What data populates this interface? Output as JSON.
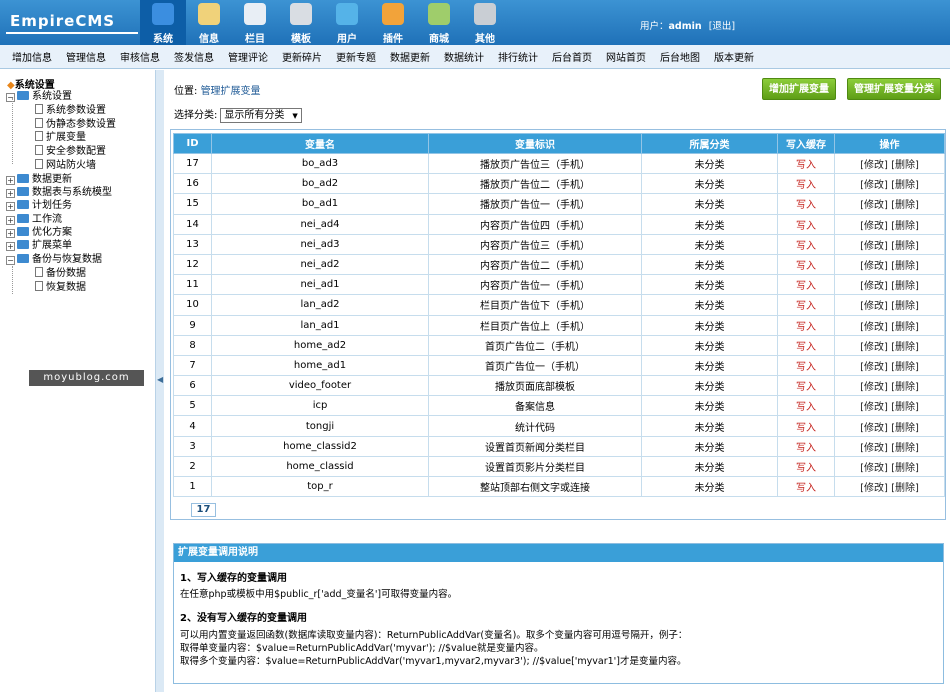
{
  "logo": "EmpireCMS",
  "topnav": [
    {
      "label": "系统",
      "icon": "globe-icon",
      "color": "#3b8ee0",
      "active": true
    },
    {
      "label": "信息",
      "icon": "document-edit-icon",
      "color": "#f0d27a"
    },
    {
      "label": "栏目",
      "icon": "folder-icon",
      "color": "#e8eef5"
    },
    {
      "label": "模板",
      "icon": "template-window-icon",
      "color": "#d9dde3"
    },
    {
      "label": "用户",
      "icon": "user-icon",
      "color": "#55b3e8"
    },
    {
      "label": "插件",
      "icon": "tools-icon",
      "color": "#f2a33a"
    },
    {
      "label": "商城",
      "icon": "shop-icon",
      "color": "#9fcd6b"
    },
    {
      "label": "其他",
      "icon": "gear-icon",
      "color": "#c9ced4"
    }
  ],
  "user": {
    "prefix": "用户：",
    "name": "admin",
    "logout": "[退出]"
  },
  "subnav": [
    "增加信息",
    "管理信息",
    "审核信息",
    "签发信息",
    "管理评论",
    "更新碎片",
    "更新专题",
    "数据更新",
    "数据统计",
    "排行统计",
    "后台首页",
    "网站首页",
    "后台地图",
    "版本更新"
  ],
  "tree": {
    "title": "系统设置",
    "nodes": [
      {
        "label": "系统设置",
        "kind": "open"
      },
      {
        "label": "系统参数设置",
        "kind": "doc"
      },
      {
        "label": "伪静态参数设置",
        "kind": "doc"
      },
      {
        "label": "扩展变量",
        "kind": "doc"
      },
      {
        "label": "安全参数配置",
        "kind": "doc"
      },
      {
        "label": "网站防火墙",
        "kind": "doc"
      },
      {
        "label": "数据更新",
        "kind": "closed"
      },
      {
        "label": "数据表与系统模型",
        "kind": "closed"
      },
      {
        "label": "计划任务",
        "kind": "closed"
      },
      {
        "label": "工作流",
        "kind": "closed"
      },
      {
        "label": "优化方案",
        "kind": "closed"
      },
      {
        "label": "扩展菜单",
        "kind": "closed"
      },
      {
        "label": "备份与恢复数据",
        "kind": "open"
      },
      {
        "label": "备份数据",
        "kind": "doc"
      },
      {
        "label": "恢复数据",
        "kind": "doc"
      }
    ]
  },
  "watermark": "moyublog.com",
  "breadcrumb": {
    "prefix": "位置: ",
    "link": "管理扩展变量"
  },
  "buttons": {
    "add": "增加扩展变量",
    "manage_class": "管理扩展变量分类"
  },
  "filter": {
    "label": "选择分类:",
    "value": "显示所有分类"
  },
  "table": {
    "headers": [
      "ID",
      "变量名",
      "变量标识",
      "所属分类",
      "写入缓存",
      "操作"
    ],
    "rows": [
      {
        "id": "17",
        "name": "bo_ad3",
        "desc": "播放页广告位三（手机）",
        "cls": "未分类",
        "cache": "写入",
        "ops": "[修改] [删除]"
      },
      {
        "id": "16",
        "name": "bo_ad2",
        "desc": "播放页广告位二（手机）",
        "cls": "未分类",
        "cache": "写入",
        "ops": "[修改] [删除]"
      },
      {
        "id": "15",
        "name": "bo_ad1",
        "desc": "播放页广告位一（手机）",
        "cls": "未分类",
        "cache": "写入",
        "ops": "[修改] [删除]"
      },
      {
        "id": "14",
        "name": "nei_ad4",
        "desc": "内容页广告位四（手机）",
        "cls": "未分类",
        "cache": "写入",
        "ops": "[修改] [删除]"
      },
      {
        "id": "13",
        "name": "nei_ad3",
        "desc": "内容页广告位三（手机）",
        "cls": "未分类",
        "cache": "写入",
        "ops": "[修改] [删除]"
      },
      {
        "id": "12",
        "name": "nei_ad2",
        "desc": "内容页广告位二（手机）",
        "cls": "未分类",
        "cache": "写入",
        "ops": "[修改] [删除]"
      },
      {
        "id": "11",
        "name": "nei_ad1",
        "desc": "内容页广告位一（手机）",
        "cls": "未分类",
        "cache": "写入",
        "ops": "[修改] [删除]"
      },
      {
        "id": "10",
        "name": "lan_ad2",
        "desc": "栏目页广告位下（手机）",
        "cls": "未分类",
        "cache": "写入",
        "ops": "[修改] [删除]"
      },
      {
        "id": "9",
        "name": "lan_ad1",
        "desc": "栏目页广告位上（手机）",
        "cls": "未分类",
        "cache": "写入",
        "ops": "[修改] [删除]"
      },
      {
        "id": "8",
        "name": "home_ad2",
        "desc": "首页广告位二（手机）",
        "cls": "未分类",
        "cache": "写入",
        "ops": "[修改] [删除]"
      },
      {
        "id": "7",
        "name": "home_ad1",
        "desc": "首页广告位一（手机）",
        "cls": "未分类",
        "cache": "写入",
        "ops": "[修改] [删除]"
      },
      {
        "id": "6",
        "name": "video_footer",
        "desc": "播放页面底部模板",
        "cls": "未分类",
        "cache": "写入",
        "ops": "[修改] [删除]"
      },
      {
        "id": "5",
        "name": "icp",
        "desc": "备案信息",
        "cls": "未分类",
        "cache": "写入",
        "ops": "[修改] [删除]"
      },
      {
        "id": "4",
        "name": "tongji",
        "desc": "统计代码",
        "cls": "未分类",
        "cache": "写入",
        "ops": "[修改] [删除]"
      },
      {
        "id": "3",
        "name": "home_classid2",
        "desc": "设置首页新闻分类栏目",
        "cls": "未分类",
        "cache": "写入",
        "ops": "[修改] [删除]"
      },
      {
        "id": "2",
        "name": "home_classid",
        "desc": "设置首页影片分类栏目",
        "cls": "未分类",
        "cache": "写入",
        "ops": "[修改] [删除]"
      },
      {
        "id": "1",
        "name": "top_r",
        "desc": "整站顶部右侧文字或连接",
        "cls": "未分类",
        "cache": "写入",
        "ops": "[修改] [删除]"
      }
    ],
    "total": "17"
  },
  "help": {
    "title": "扩展变量调用说明",
    "s1_title": "1、写入缓存的变量调用",
    "s1_text": "在任意php或模板中用$public_r['add_变量名']可取得变量内容。",
    "s2_title": "2、没有写入缓存的变量调用",
    "s2_line1": "可以用内置变量返回函数(数据库读取变量内容)：ReturnPublicAddVar(变量名)。取多个变量内容可用逗号隔开，例子：",
    "s2_line2": "取得单变量内容：$value=ReturnPublicAddVar('myvar'); //$value就是变量内容。",
    "s2_line3": "取得多个变量内容：$value=ReturnPublicAddVar('myvar1,myvar2,myvar3'); //$value['myvar1']才是变量内容。"
  }
}
